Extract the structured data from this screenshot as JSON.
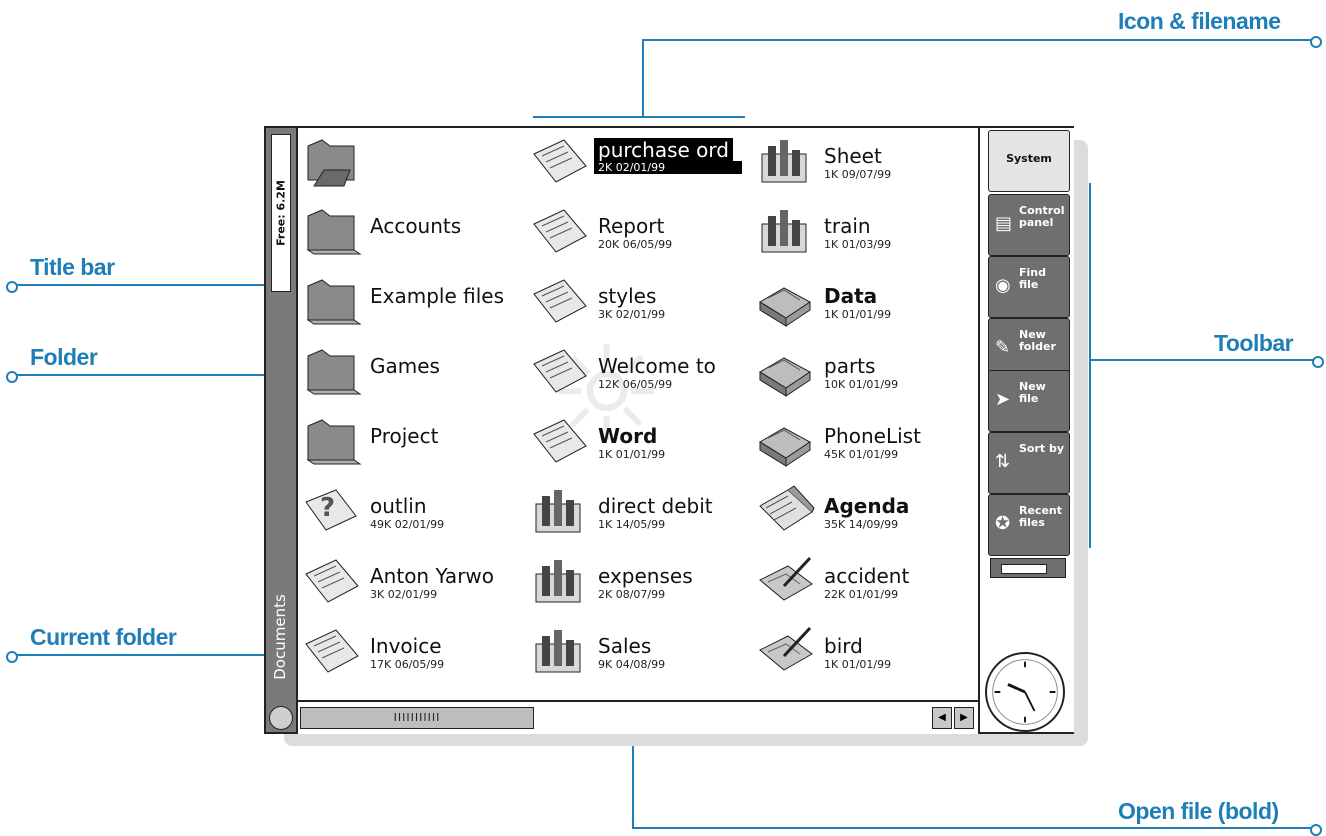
{
  "callouts": {
    "icon_filename": "Icon & filename",
    "title_bar": "Title bar",
    "folder": "Folder",
    "toolbar": "Toolbar",
    "current_folder": "Current folder",
    "open_file": "Open file (bold)"
  },
  "titlebar": {
    "free_space": "Free: 6.2M",
    "current_folder": "Documents"
  },
  "files": [
    {
      "name": "",
      "meta": "",
      "icon": "folder-up-icon"
    },
    {
      "name": "Accounts",
      "meta": "",
      "icon": "folder-icon"
    },
    {
      "name": "Example files",
      "meta": "",
      "icon": "folder-icon"
    },
    {
      "name": "Games",
      "meta": "",
      "icon": "folder-icon"
    },
    {
      "name": "Project",
      "meta": "",
      "icon": "folder-icon"
    },
    {
      "name": "outlin",
      "meta": "49K 02/01/99",
      "icon": "outline-doc-icon"
    },
    {
      "name": "Anton Yarwo",
      "meta": "3K 02/01/99",
      "icon": "word-doc-icon"
    },
    {
      "name": "Invoice",
      "meta": "17K 06/05/99",
      "icon": "word-doc-icon"
    },
    {
      "name": "purchase ord",
      "meta": "2K 02/01/99",
      "icon": "word-doc-icon"
    },
    {
      "name": "Report",
      "meta": "20K 06/05/99",
      "icon": "word-doc-icon"
    },
    {
      "name": "styles",
      "meta": "3K 02/01/99",
      "icon": "word-doc-icon"
    },
    {
      "name": "Welcome to",
      "meta": "12K 06/05/99",
      "icon": "word-doc-icon"
    },
    {
      "name": "Word",
      "meta": "1K 01/01/99",
      "icon": "word-doc-icon"
    },
    {
      "name": "direct debit",
      "meta": "1K 14/05/99",
      "icon": "sheet-icon"
    },
    {
      "name": "expenses",
      "meta": "2K 08/07/99",
      "icon": "sheet-icon"
    },
    {
      "name": "Sales",
      "meta": "9K 04/08/99",
      "icon": "sheet-icon"
    },
    {
      "name": "Sheet",
      "meta": "1K 09/07/99",
      "icon": "sheet-icon"
    },
    {
      "name": "train",
      "meta": "1K 01/03/99",
      "icon": "sheet-icon"
    },
    {
      "name": "Data",
      "meta": "1K 01/01/99",
      "icon": "database-icon"
    },
    {
      "name": "parts",
      "meta": "10K 01/01/99",
      "icon": "database-icon"
    },
    {
      "name": "PhoneList",
      "meta": "45K 01/01/99",
      "icon": "database-icon"
    },
    {
      "name": "Agenda",
      "meta": "35K 14/09/99",
      "icon": "agenda-icon"
    },
    {
      "name": "accident",
      "meta": "22K 01/01/99",
      "icon": "sketch-icon"
    },
    {
      "name": "bird",
      "meta": "1K 01/01/99",
      "icon": "sketch-icon"
    }
  ],
  "scrollbar": {
    "thumb_label": "IIIIIIIIIII"
  },
  "toolbar": {
    "system": "System",
    "control_panel": "Control panel",
    "find_file": "Find file",
    "new_folder": "New folder",
    "new_file": "New file",
    "sort_by": "Sort by",
    "recent_files": "Recent files"
  },
  "colors": {
    "callout": "#1e7fb8",
    "button_gray": "#6f6f6f",
    "titlebar_gray": "#7a7a7a"
  }
}
